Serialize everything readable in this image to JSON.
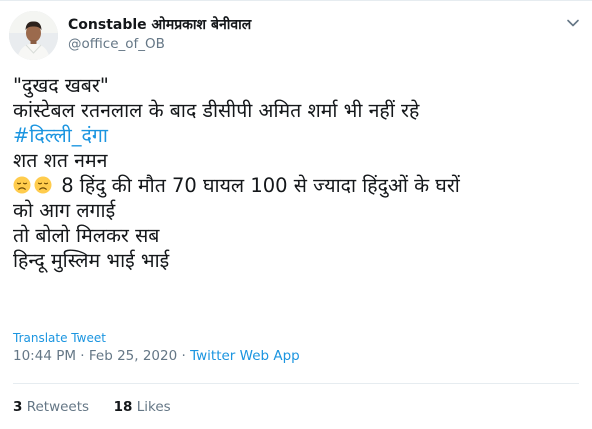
{
  "user": {
    "display_name": "Constable ओमप्रकाश बेनीवाल",
    "handle": "@office_of_OB",
    "avatar_icon": "profile-photo"
  },
  "tweet": {
    "line1": "\"दुखद खबर\"",
    "line2": "कांस्टेबल रतनलाल के बाद डीसीपी अमित शर्मा भी नहीं रहे",
    "hashtag": "#दिल्ली_दंगा",
    "line4": "शत शत नमन",
    "emoji": "disappointed-face-icon",
    "line5": "8 हिंदु की मौत 70 घायल 100 से ज्यादा हिंदुओं के घरों",
    "line6": "को आग लगाई",
    "line7": "तो बोलो मिलकर सब",
    "line8": "हिन्दू मुस्लिम भाई भाई"
  },
  "translate_label": "Translate Tweet",
  "meta": {
    "time": "10:44 PM",
    "separator1": "·",
    "date": "Feb 25, 2020",
    "separator2": "·",
    "source": "Twitter Web App"
  },
  "stats": {
    "retweets_count": "3",
    "retweets_label": "Retweets",
    "likes_count": "18",
    "likes_label": "Likes"
  },
  "colors": {
    "link": "#1b95e0",
    "secondary_text": "#657786",
    "primary_text": "#14171a",
    "divider": "#e6ecf0"
  }
}
